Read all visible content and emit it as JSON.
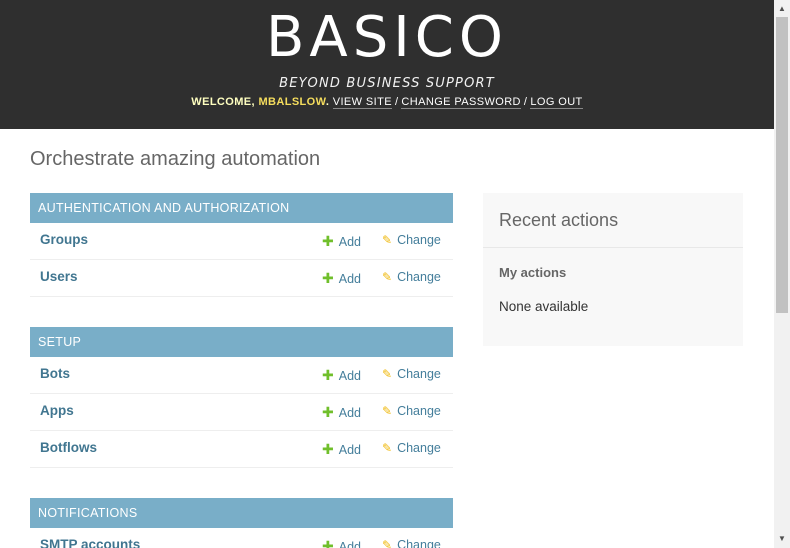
{
  "header": {
    "logo": "BASICO",
    "tagline": "BEYOND BUSINESS SUPPORT",
    "welcome": "WELCOME, ",
    "username": "MBALSLOW",
    "links": [
      "VIEW SITE",
      "CHANGE PASSWORD",
      "LOG OUT"
    ]
  },
  "page_title": "Orchestrate amazing automation",
  "modules": [
    {
      "caption": "Authentication and Authorization",
      "models": [
        {
          "name": "Groups",
          "add": "Add",
          "change": "Change"
        },
        {
          "name": "Users",
          "add": "Add",
          "change": "Change"
        }
      ]
    },
    {
      "caption": "Setup",
      "models": [
        {
          "name": "Bots",
          "add": "Add",
          "change": "Change"
        },
        {
          "name": "Apps",
          "add": "Add",
          "change": "Change"
        },
        {
          "name": "Botflows",
          "add": "Add",
          "change": "Change"
        }
      ]
    },
    {
      "caption": "Notifications",
      "models": [
        {
          "name": "SMTP accounts",
          "add": "Add",
          "change": "Change"
        }
      ]
    }
  ],
  "recent_actions": {
    "title": "Recent actions",
    "subtitle": "My actions",
    "empty": "None available"
  },
  "colors": {
    "header_bg": "#2f2f2f",
    "caption_bg": "#79aec8",
    "link": "#417690",
    "add_icon": "#70bf2b",
    "change_icon": "#efb80b"
  }
}
